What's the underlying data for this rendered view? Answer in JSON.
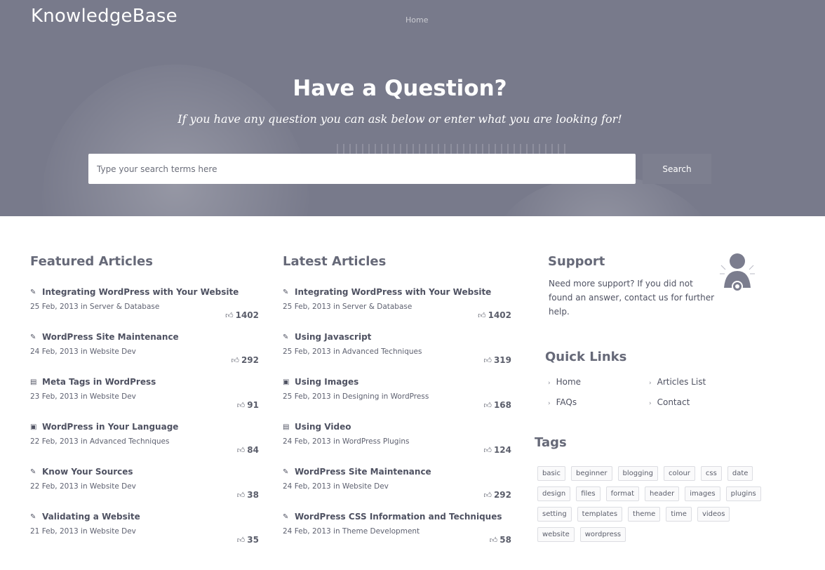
{
  "header": {
    "logo": "KnowledgeBase",
    "nav": [
      "Home",
      "",
      "",
      "",
      "",
      "",
      ""
    ]
  },
  "hero": {
    "title": "Have a Question?",
    "subtitle": "If you have any question you can ask below or enter what you are looking for!",
    "search_placeholder": "Type your search terms here",
    "search_button": "Search"
  },
  "featured": {
    "heading": "Featured Articles",
    "articles": [
      {
        "icon": "edit-icon",
        "title": "Integrating WordPress with Your Website",
        "meta": "25 Feb, 2013 in Server & Database",
        "likes": "1402"
      },
      {
        "icon": "edit-icon",
        "title": "WordPress Site Maintenance",
        "meta": "24 Feb, 2013 in Website Dev",
        "likes": "292"
      },
      {
        "icon": "film-icon",
        "title": "Meta Tags in WordPress",
        "meta": "23 Feb, 2013 in Website Dev",
        "likes": "91"
      },
      {
        "icon": "image-icon",
        "title": "WordPress in Your Language",
        "meta": "22 Feb, 2013 in Advanced Techniques",
        "likes": "84"
      },
      {
        "icon": "edit-icon",
        "title": "Know Your Sources",
        "meta": "22 Feb, 2013 in Website Dev",
        "likes": "38"
      },
      {
        "icon": "edit-icon",
        "title": "Validating a Website",
        "meta": "21 Feb, 2013 in Website Dev",
        "likes": "35"
      }
    ]
  },
  "latest": {
    "heading": "Latest Articles",
    "articles": [
      {
        "icon": "edit-icon",
        "title": "Integrating WordPress with Your Website",
        "meta": "25 Feb, 2013 in Server & Database",
        "likes": "1402"
      },
      {
        "icon": "edit-icon",
        "title": "Using Javascript",
        "meta": "25 Feb, 2013 in Advanced Techniques",
        "likes": "319"
      },
      {
        "icon": "image-icon",
        "title": "Using Images",
        "meta": "25 Feb, 2013 in Designing in WordPress",
        "likes": "168"
      },
      {
        "icon": "film-icon",
        "title": "Using Video",
        "meta": "24 Feb, 2013 in WordPress Plugins",
        "likes": "124"
      },
      {
        "icon": "edit-icon",
        "title": "WordPress Site Maintenance",
        "meta": "24 Feb, 2013 in Website Dev",
        "likes": "292"
      },
      {
        "icon": "edit-icon",
        "title": "WordPress CSS Information and Techniques",
        "meta": "24 Feb, 2013 in Theme Development",
        "likes": "58"
      }
    ]
  },
  "support": {
    "heading": "Support",
    "text": "Need more support? If you did not found an answer, contact us for further help."
  },
  "quick_links": {
    "heading": "Quick Links",
    "items": [
      "Home",
      "Articles List",
      "FAQs",
      "Contact"
    ]
  },
  "tags": {
    "heading": "Tags",
    "items": [
      "basic",
      "beginner",
      "blogging",
      "colour",
      "css",
      "date",
      "design",
      "files",
      "format",
      "header",
      "images",
      "plugins",
      "setting",
      "templates",
      "theme",
      "time",
      "videos",
      "website",
      "wordpress"
    ]
  }
}
